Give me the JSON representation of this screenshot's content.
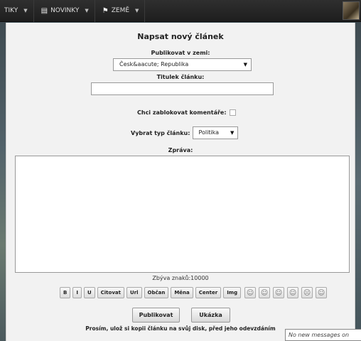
{
  "nav": {
    "items": [
      {
        "label": "TIKY",
        "caret": "▼"
      },
      {
        "label": "NOVINKY",
        "caret": "▼"
      },
      {
        "label": "ZEMĚ",
        "caret": "▼"
      }
    ]
  },
  "form": {
    "title": "Napsat nový článek",
    "country_label": "Publikovat v zemi:",
    "country_value": "Česk&aacute; Republika",
    "article_title_label": "Titulek článku:",
    "article_title_value": "",
    "block_comments_label": "Chci zablokovat komentáře:",
    "block_comments_checked": false,
    "type_label": "Vybrat typ článku:",
    "type_value": "Politika",
    "message_label": "Zpráva:",
    "message_value": "",
    "chars_left": "Zbýva znaků:10000",
    "toolbar": [
      "B",
      "I",
      "U",
      "Citovat",
      "Url",
      "Občan",
      "Měna",
      "Center",
      "Img"
    ],
    "smileys": [
      "☺",
      "☺",
      "☺",
      "☺",
      "☹",
      "☺"
    ],
    "publish_label": "Publikovat",
    "preview_label": "Ukázka",
    "notice": "Prosím, ulož si kopii článku na svůj disk, před jeho odevzdáním"
  },
  "messages": {
    "status": "No new messages on"
  }
}
